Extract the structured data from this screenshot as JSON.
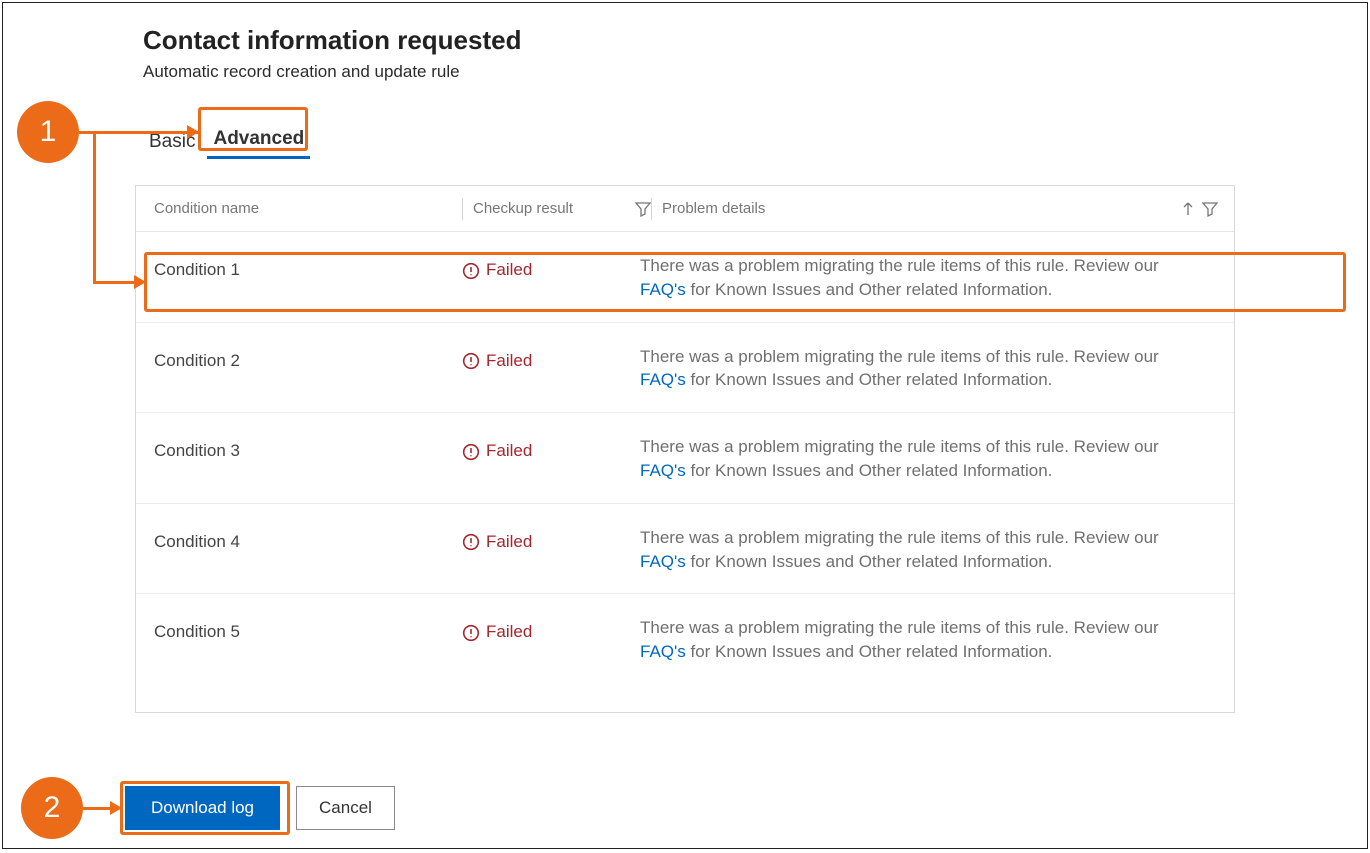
{
  "header": {
    "title": "Contact information requested",
    "subtitle": "Automatic record creation and update rule"
  },
  "tabs": {
    "basic": "Basic",
    "advanced": "Advanced",
    "active": "advanced"
  },
  "grid": {
    "columns": {
      "name": "Condition name",
      "result": "Checkup result",
      "details": "Problem details"
    },
    "faq_label": "FAQ's",
    "problem_prefix": "There was a problem migrating the rule items of this rule. Review our ",
    "problem_suffix": " for Known Issues and Other related Information.",
    "rows": [
      {
        "name": "Condition 1",
        "result": "Failed"
      },
      {
        "name": "Condition 2",
        "result": "Failed"
      },
      {
        "name": "Condition 3",
        "result": "Failed"
      },
      {
        "name": "Condition 4",
        "result": "Failed"
      },
      {
        "name": "Condition 5",
        "result": "Failed"
      }
    ]
  },
  "buttons": {
    "download_log": "Download log",
    "cancel": "Cancel"
  },
  "callouts": {
    "one": "1",
    "two": "2"
  }
}
